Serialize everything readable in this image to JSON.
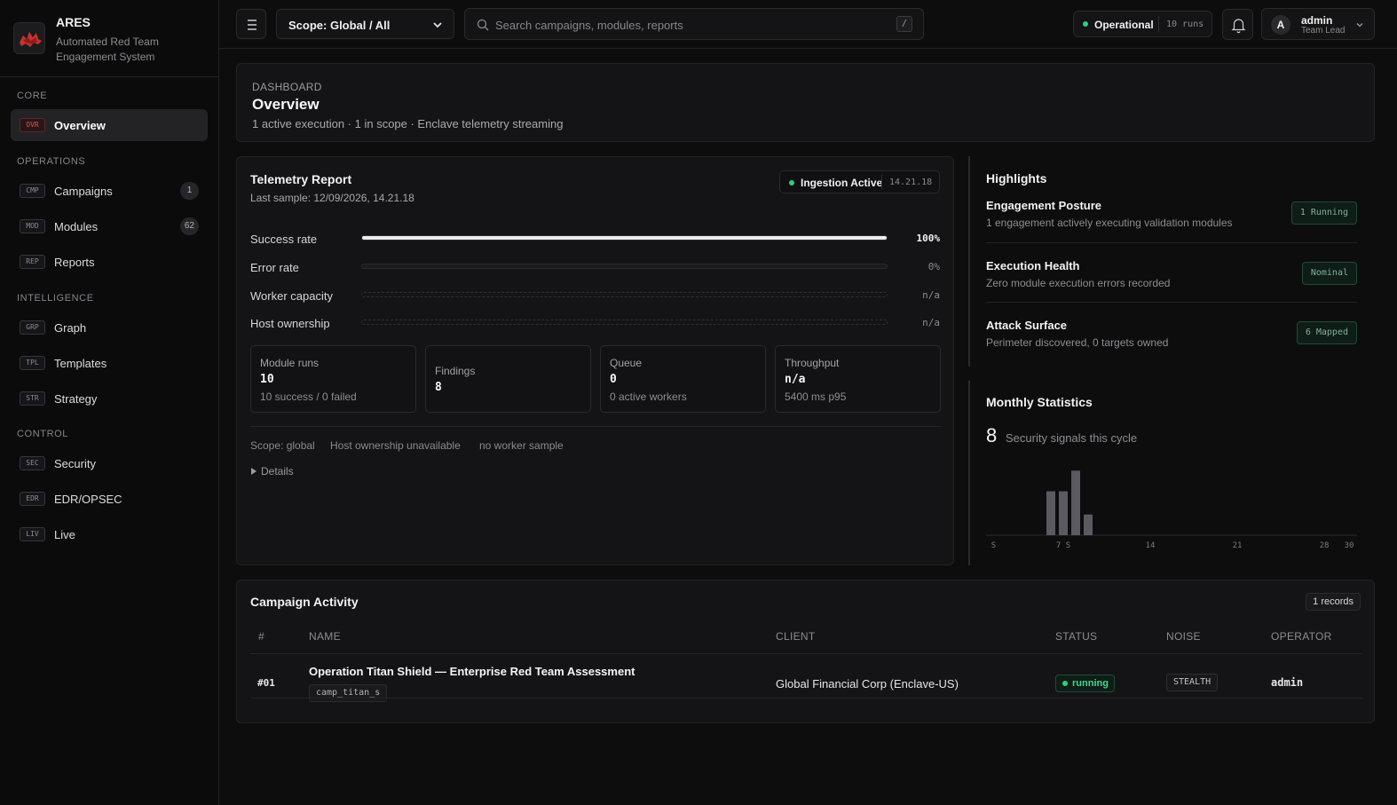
{
  "brand": {
    "name": "ARES",
    "tagline": "Automated Red Team Engagement System"
  },
  "sidebar": {
    "groups": [
      {
        "label": "CORE",
        "items": [
          {
            "code": "OVR",
            "label": "Overview",
            "active": true
          }
        ]
      },
      {
        "label": "OPERATIONS",
        "items": [
          {
            "code": "CMP",
            "label": "Campaigns",
            "badge": "1"
          },
          {
            "code": "MOD",
            "label": "Modules",
            "badge": "62"
          },
          {
            "code": "REP",
            "label": "Reports"
          }
        ]
      },
      {
        "label": "INTELLIGENCE",
        "items": [
          {
            "code": "GRP",
            "label": "Graph"
          },
          {
            "code": "TPL",
            "label": "Templates"
          },
          {
            "code": "STR",
            "label": "Strategy"
          }
        ]
      },
      {
        "label": "CONTROL",
        "items": [
          {
            "code": "SEC",
            "label": "Security"
          },
          {
            "code": "EDR",
            "label": "EDR/OPSEC"
          },
          {
            "code": "LIV",
            "label": "Live"
          }
        ]
      }
    ]
  },
  "topbar": {
    "scope": "Scope: Global / All",
    "search_placeholder": "Search campaigns, modules, reports",
    "search_shortcut": "/",
    "status": "Operational",
    "runs": "10 runs",
    "user": {
      "initial": "A",
      "name": "admin",
      "role": "Team Lead"
    }
  },
  "header": {
    "eyebrow": "DASHBOARD",
    "title": "Overview",
    "subtitle": "1 active execution · 1 in scope · Enclave telemetry streaming"
  },
  "telemetry": {
    "title": "Telemetry Report",
    "last_sample": "Last sample: 12/09/2026, 14.21.18",
    "ingestion": "Ingestion Active",
    "ingestion_time": "14.21.18",
    "metrics": [
      {
        "label": "Success rate",
        "value": "100%",
        "fraction": 1.0,
        "style": "filled"
      },
      {
        "label": "Error rate",
        "value": "0%",
        "fraction": 0.0,
        "style": "track"
      },
      {
        "label": "Worker capacity",
        "value": "n/a",
        "fraction": 0.0,
        "style": "dashed"
      },
      {
        "label": "Host ownership",
        "value": "n/a",
        "fraction": 0.0,
        "style": "dashed"
      }
    ],
    "stats": [
      {
        "label": "Module runs",
        "value": "10",
        "sub": "10 success / 0 failed"
      },
      {
        "label": "Findings",
        "value": "8",
        "sub": ""
      },
      {
        "label": "Queue",
        "value": "0",
        "sub": "0 active workers"
      },
      {
        "label": "Throughput",
        "value": "n/a",
        "sub": "5400 ms p95"
      }
    ],
    "footer_tags": [
      "Scope: global",
      "Host ownership unavailable",
      "no worker sample"
    ],
    "details": "Details"
  },
  "highlights": {
    "title": "Highlights",
    "items": [
      {
        "title": "Engagement Posture",
        "subtitle": "1 engagement actively executing validation modules",
        "tag": "1 Running"
      },
      {
        "title": "Execution Health",
        "subtitle": "Zero module execution errors recorded",
        "tag": "Nominal"
      },
      {
        "title": "Attack Surface",
        "subtitle": "Perimeter discovered, 0 targets owned",
        "tag": "6 Mapped"
      }
    ]
  },
  "monthly": {
    "title": "Monthly Statistics",
    "count": "8",
    "count_label": "Security signals this cycle",
    "chart_data": {
      "type": "bar",
      "x": [
        6,
        7,
        8,
        9
      ],
      "values": [
        3.4,
        3.4,
        5,
        1.6
      ],
      "xlim": [
        1,
        30
      ],
      "xticks": [
        "1 S",
        "7 S",
        "14",
        "21",
        "28",
        "30"
      ],
      "xtick_positions": [
        1,
        7,
        14,
        21,
        28,
        30
      ],
      "ylim": [
        0,
        5.5
      ]
    }
  },
  "campaigns": {
    "title": "Campaign Activity",
    "records": "1 records",
    "columns": [
      "#",
      "NAME",
      "CLIENT",
      "STATUS",
      "NOISE",
      "OPERATOR"
    ],
    "rows": [
      {
        "index": "#01",
        "name": "Operation Titan Shield — Enterprise Red Team Assessment",
        "id": "camp_titan_s",
        "client": "Global Financial Corp (Enclave-US)",
        "status": "running",
        "noise": "STEALTH",
        "operator": "admin"
      }
    ]
  },
  "colors": {
    "accent_green": "#2fcf7f",
    "brand_red": "#e0555c",
    "background": "#0d0d0e",
    "card": "#141416"
  }
}
